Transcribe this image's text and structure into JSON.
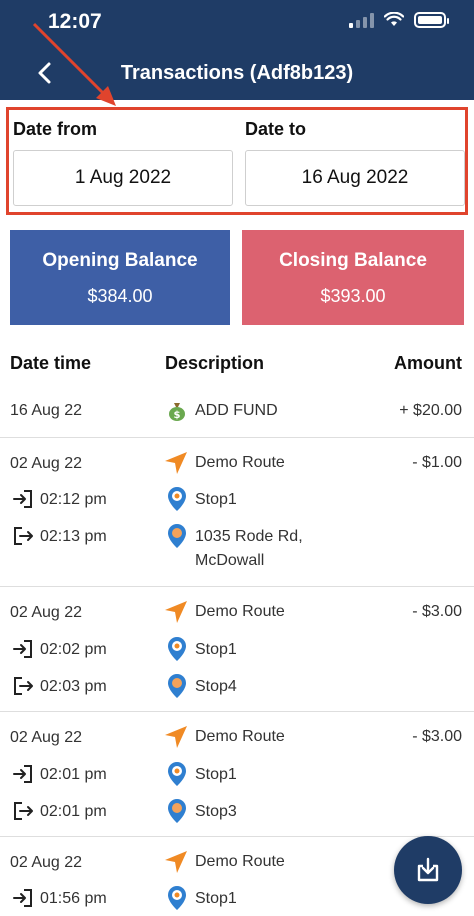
{
  "status_bar": {
    "time": "12:07"
  },
  "header": {
    "title": "Transactions (Adf8b123)"
  },
  "date_range": {
    "from_label": "Date from",
    "from_value": "1 Aug 2022",
    "to_label": "Date to",
    "to_value": "16 Aug 2022"
  },
  "balances": {
    "opening": {
      "label": "Opening Balance",
      "amount": "$384.00",
      "color": "#3e5fa6"
    },
    "closing": {
      "label": "Closing Balance",
      "amount": "$393.00",
      "color": "#dc6270"
    }
  },
  "table": {
    "headers": {
      "datetime": "Date time",
      "description": "Description",
      "amount": "Amount"
    },
    "fund_row": {
      "date": "16 Aug 22",
      "description": "ADD FUND",
      "amount": "+ $20.00"
    },
    "trips": [
      {
        "date": "02 Aug 22",
        "route": "Demo Route",
        "amount": "- $1.00",
        "in_time": "02:12 pm",
        "start_stop": "Stop1",
        "out_time": "02:13 pm",
        "end_stop_line1": "1035 Rode Rd,",
        "end_stop_line2": "McDowall"
      },
      {
        "date": "02 Aug 22",
        "route": "Demo Route",
        "amount": "- $3.00",
        "in_time": "02:02 pm",
        "start_stop": "Stop1",
        "out_time": "02:03 pm",
        "end_stop_line1": "Stop4"
      },
      {
        "date": "02 Aug 22",
        "route": "Demo Route",
        "amount": "- $3.00",
        "in_time": "02:01 pm",
        "start_stop": "Stop1",
        "out_time": "02:01 pm",
        "end_stop_line1": "Stop3"
      },
      {
        "date": "02 Aug 22",
        "route": "Demo Route",
        "in_time": "01:56 pm",
        "start_stop": "Stop1"
      }
    ]
  },
  "colors": {
    "header": "#1f3c66",
    "highlight": "#e0442d",
    "route_icon": "#f08a24"
  },
  "icons": [
    "back-arrow-icon",
    "money-bag-icon",
    "route-arrow-icon",
    "check-in-icon",
    "check-out-icon",
    "location-pin-icon",
    "download-icon"
  ]
}
